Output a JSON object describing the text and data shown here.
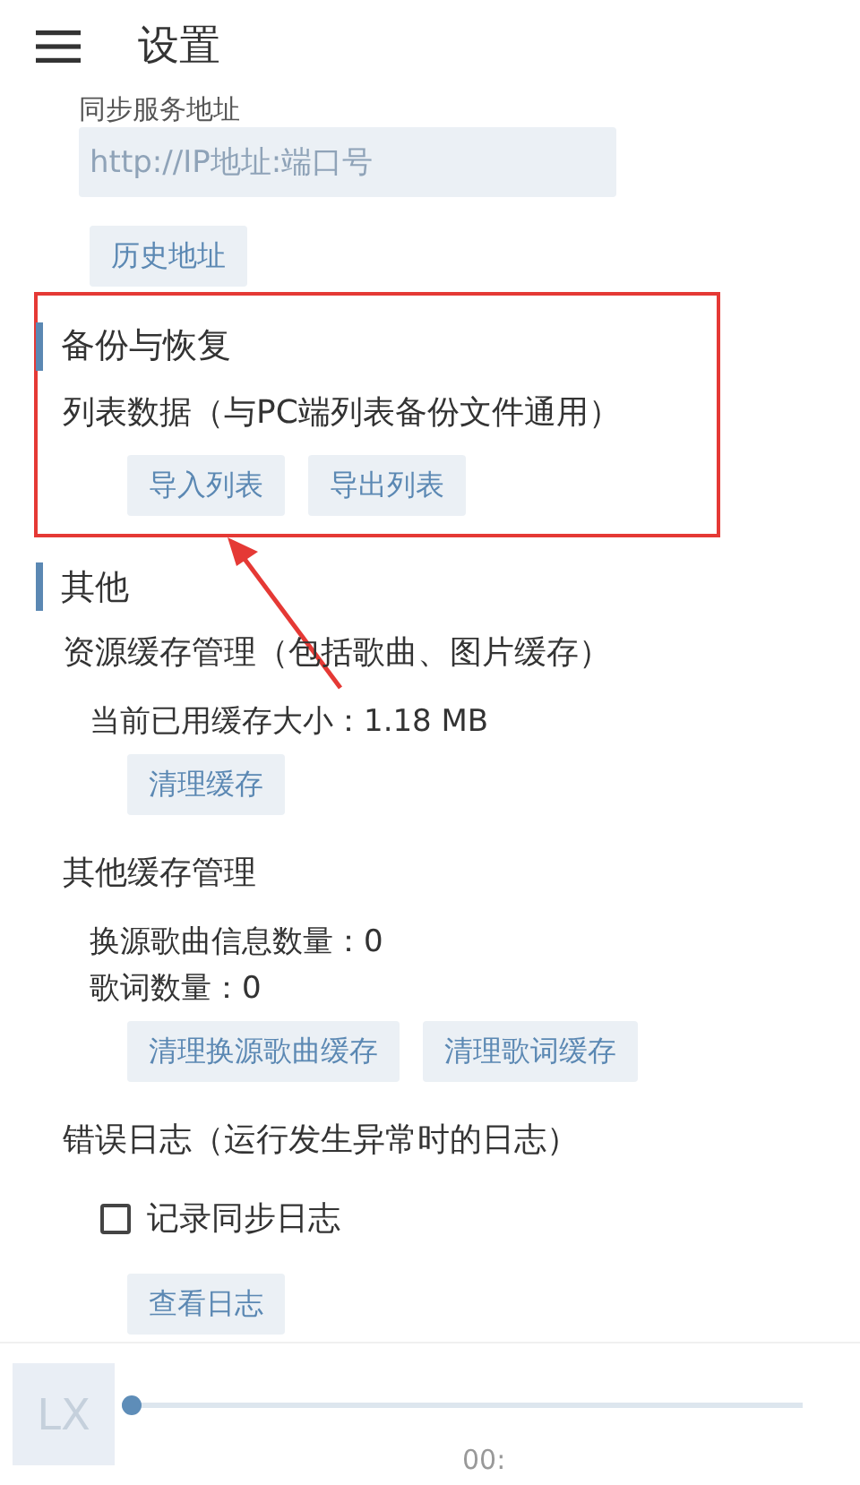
{
  "header": {
    "title": "设置"
  },
  "sync": {
    "label": "同步服务地址",
    "placeholder": "http://IP地址:端口号",
    "buttons": [
      "历史地址"
    ]
  },
  "sections": [
    {
      "title": "备份与恢复",
      "highlighted": true,
      "groups": [
        {
          "title": "列表数据（与PC端列表备份文件通用）",
          "buttons": [
            "导入列表",
            "导出列表"
          ]
        }
      ]
    },
    {
      "title": "其他",
      "highlighted": false,
      "groups": [
        {
          "title": "资源缓存管理（包括歌曲、图片缓存）",
          "lines": [
            "当前已用缓存大小：1.18 MB"
          ],
          "buttons": [
            "清理缓存"
          ]
        },
        {
          "title": "其他缓存管理",
          "lines": [
            "换源歌曲信息数量：0",
            "歌词数量：0"
          ],
          "buttons": [
            "清理换源歌曲缓存",
            "清理歌词缓存"
          ]
        },
        {
          "title": "错误日志（运行发生异常时的日志）",
          "checkboxes": [
            {
              "label": "记录同步日志",
              "checked": false
            }
          ],
          "buttons": [
            "查看日志"
          ]
        }
      ]
    }
  ],
  "player": {
    "cover": "LX",
    "level": 0,
    "time": "00:"
  }
}
